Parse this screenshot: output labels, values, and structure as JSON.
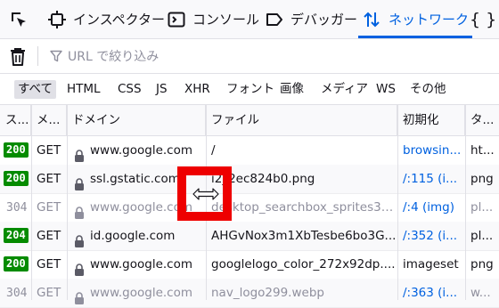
{
  "toolbar": {
    "tabs": [
      {
        "label": "インスペクター",
        "icon": "inspector-icon"
      },
      {
        "label": "コンソール",
        "icon": "console-icon"
      },
      {
        "label": "デバッガー",
        "icon": "debugger-icon"
      },
      {
        "label": "ネットワーク",
        "icon": "network-icon",
        "active": true
      },
      {
        "label": "",
        "icon": "style-editor-icon"
      }
    ]
  },
  "filter": {
    "placeholder": "URL で絞り込み"
  },
  "type_filters": [
    "すべて",
    "HTML",
    "CSS",
    "JS",
    "XHR",
    "フォント",
    "画像",
    "メディア",
    "WS",
    "その他"
  ],
  "columns": [
    "ス...",
    "メ...",
    "ドメイン",
    "ファイル",
    "初期化",
    "タ..."
  ],
  "requests": [
    {
      "status": "200",
      "method": "GET",
      "domain": "www.google.com",
      "file": "/",
      "initiator": "browsin...",
      "type": "ht..."
    },
    {
      "status": "200",
      "method": "GET",
      "domain": "ssl.gstatic.com",
      "file": "i2_2ec824b0.png",
      "initiator": "/:115 (i...",
      "type": "png"
    },
    {
      "status": "304",
      "method": "GET",
      "domain": "www.google.com",
      "file": "desktop_searchbox_sprites30...",
      "initiator": "/:4 (img)",
      "type": "pl..."
    },
    {
      "status": "204",
      "method": "GET",
      "domain": "id.google.com",
      "file": "AHGvNox3m1XbTesbe6bo3G...",
      "initiator": "/:352 (i...",
      "type": "pl..."
    },
    {
      "status": "200",
      "method": "GET",
      "domain": "www.google.com",
      "file": "googlelogo_color_272x92dp....",
      "initiator": "imageset",
      "type": "png"
    },
    {
      "status": "304",
      "method": "GET",
      "domain": "www.google.com",
      "file": "nav_logo299.webp",
      "initiator": "/:363 (i...",
      "type": "w..."
    }
  ],
  "colors": {
    "accent": "#0061e0",
    "status_ok": "#058b00",
    "highlight": "#ee0000"
  }
}
